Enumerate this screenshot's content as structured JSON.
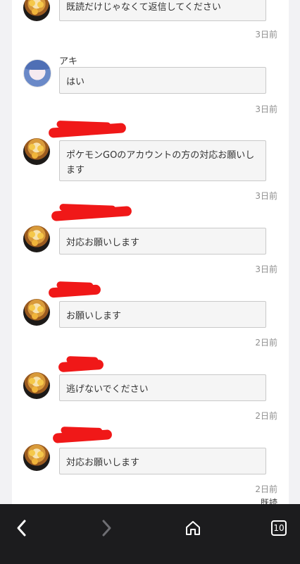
{
  "messages": [
    {
      "avatar": "ramen-avatar",
      "name": "",
      "text": "既読だけじゃなくて返信してください",
      "time": "3日前",
      "name_redacted": false
    },
    {
      "avatar": "anime-avatar",
      "name": "アキ",
      "text": "はい",
      "time": "3日前",
      "name_redacted": false
    },
    {
      "avatar": "ramen-avatar",
      "name": "",
      "text": "ポケモンGOのアカウントの方の対応お願いします",
      "time": "3日前",
      "name_redacted": true
    },
    {
      "avatar": "ramen-avatar",
      "name": "",
      "text": "対応お願いします",
      "time": "3日前",
      "name_redacted": true
    },
    {
      "avatar": "ramen-avatar",
      "name": "",
      "text": "お願いします",
      "time": "2日前",
      "name_redacted": true
    },
    {
      "avatar": "ramen-avatar",
      "name": "",
      "text": "逃げないでください",
      "time": "2日前",
      "name_redacted": true
    },
    {
      "avatar": "ramen-avatar",
      "name": "",
      "text": "対応お願いします",
      "time": "2日前",
      "name_redacted": true
    }
  ],
  "read_label": "既読",
  "browser_bar": {
    "back_icon": "chevron-left-icon",
    "forward_icon": "chevron-right-icon",
    "home_icon": "home-icon",
    "tab_count": "10"
  },
  "colors": {
    "redaction": "#f01818",
    "bar_bg": "#1c1c1e"
  }
}
